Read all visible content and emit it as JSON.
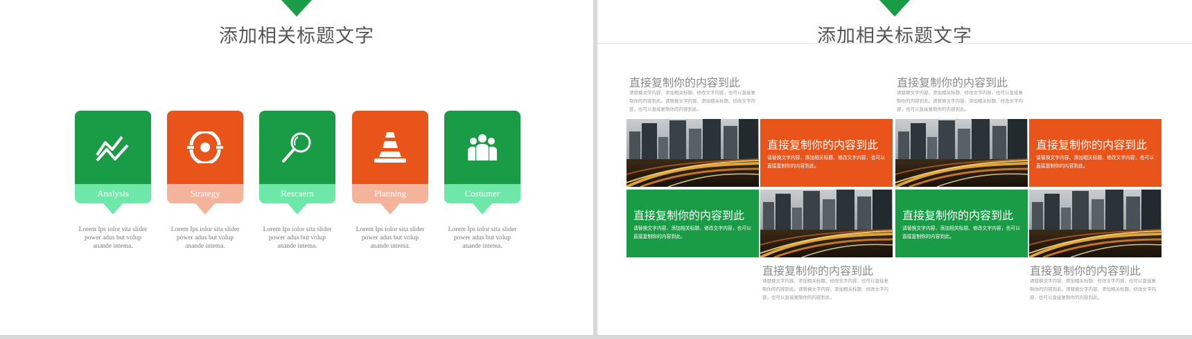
{
  "colors": {
    "green": "#1a9b46",
    "light_green": "#6ee8a8",
    "orange": "#e8541a",
    "light_orange": "#f4b49c"
  },
  "left_slide": {
    "title": "添加相关标题文字",
    "cards": [
      {
        "icon": "trend-line-icon",
        "label": "Analysis",
        "desc": "Lorem Ips iolor  sita slider power adus but volup anande intema."
      },
      {
        "icon": "eye-target-icon",
        "label": "Strategy",
        "desc": "Lorem Ips iolor  sita slider power adus but volup anande intema."
      },
      {
        "icon": "magnifier-icon",
        "label": "Rescaern",
        "desc": "Lorem Ips iolor  sita slider power adus but volup anande intema."
      },
      {
        "icon": "traffic-cone-icon",
        "label": "Planning",
        "desc": "Lorem Ips iolor  sita slider power adus but volup anande intema."
      },
      {
        "icon": "people-group-icon",
        "label": "Costumer",
        "desc": "Lorem Ips iolor  sita slider power adus but volup anande intema."
      }
    ]
  },
  "right_slide": {
    "title": "添加相关标题文字",
    "text_blocks": [
      {
        "title": "直接复制你的内容到此",
        "body": "请替换文字内容、添加相关标题、修改文字内容，也可以直接复制你的内容到此。请替换文字内容、添加相关标题、修改文字内容，也可以直接复制你的内容到此。"
      },
      {
        "title": "直接复制你的内容到此",
        "body": "请替换文字内容、添加相关标题、修改文字内容，也可以直接复制你的内容到此。请替换文字内容、添加相关标题、修改文字内容，也可以直接复制你的内容到此。"
      },
      {
        "title": "直接复制你的内容到此",
        "body": "请替换文字内容、添加相关标题、修改文字内容，也可以直接复制你的内容到此。请替换文字内容、添加相关标题、修改文字内容，也可以直接复制你的内容到此。"
      },
      {
        "title": "直接复制你的内容到此",
        "body": "请替换文字内容、添加相关标题、修改文字内容，也可以直接复制你的内容到此。请替换文字内容、添加相关标题、修改文字内容，也可以直接复制你的内容到此。"
      }
    ],
    "tiles": [
      {
        "title": "直接复制你的内容到此",
        "body": "请替换文字内容、添加相关标题、修改文字内容，也可以直接复制你的内容到此。"
      },
      {
        "title": "直接复制你的内容到此",
        "body": "请替换文字内容、添加相关标题、修改文字内容，也可以直接复制你的内容到此。"
      },
      {
        "title": "直接复制你的内容到此",
        "body": "请替换文字内容、添加相关标题、修改文字内容，也可以直接复制你的内容到此。"
      },
      {
        "title": "直接复制你的内容到此",
        "body": "请替换文字内容、添加相关标题、修改文字内容，也可以直接复制你的内容到此。"
      }
    ]
  }
}
